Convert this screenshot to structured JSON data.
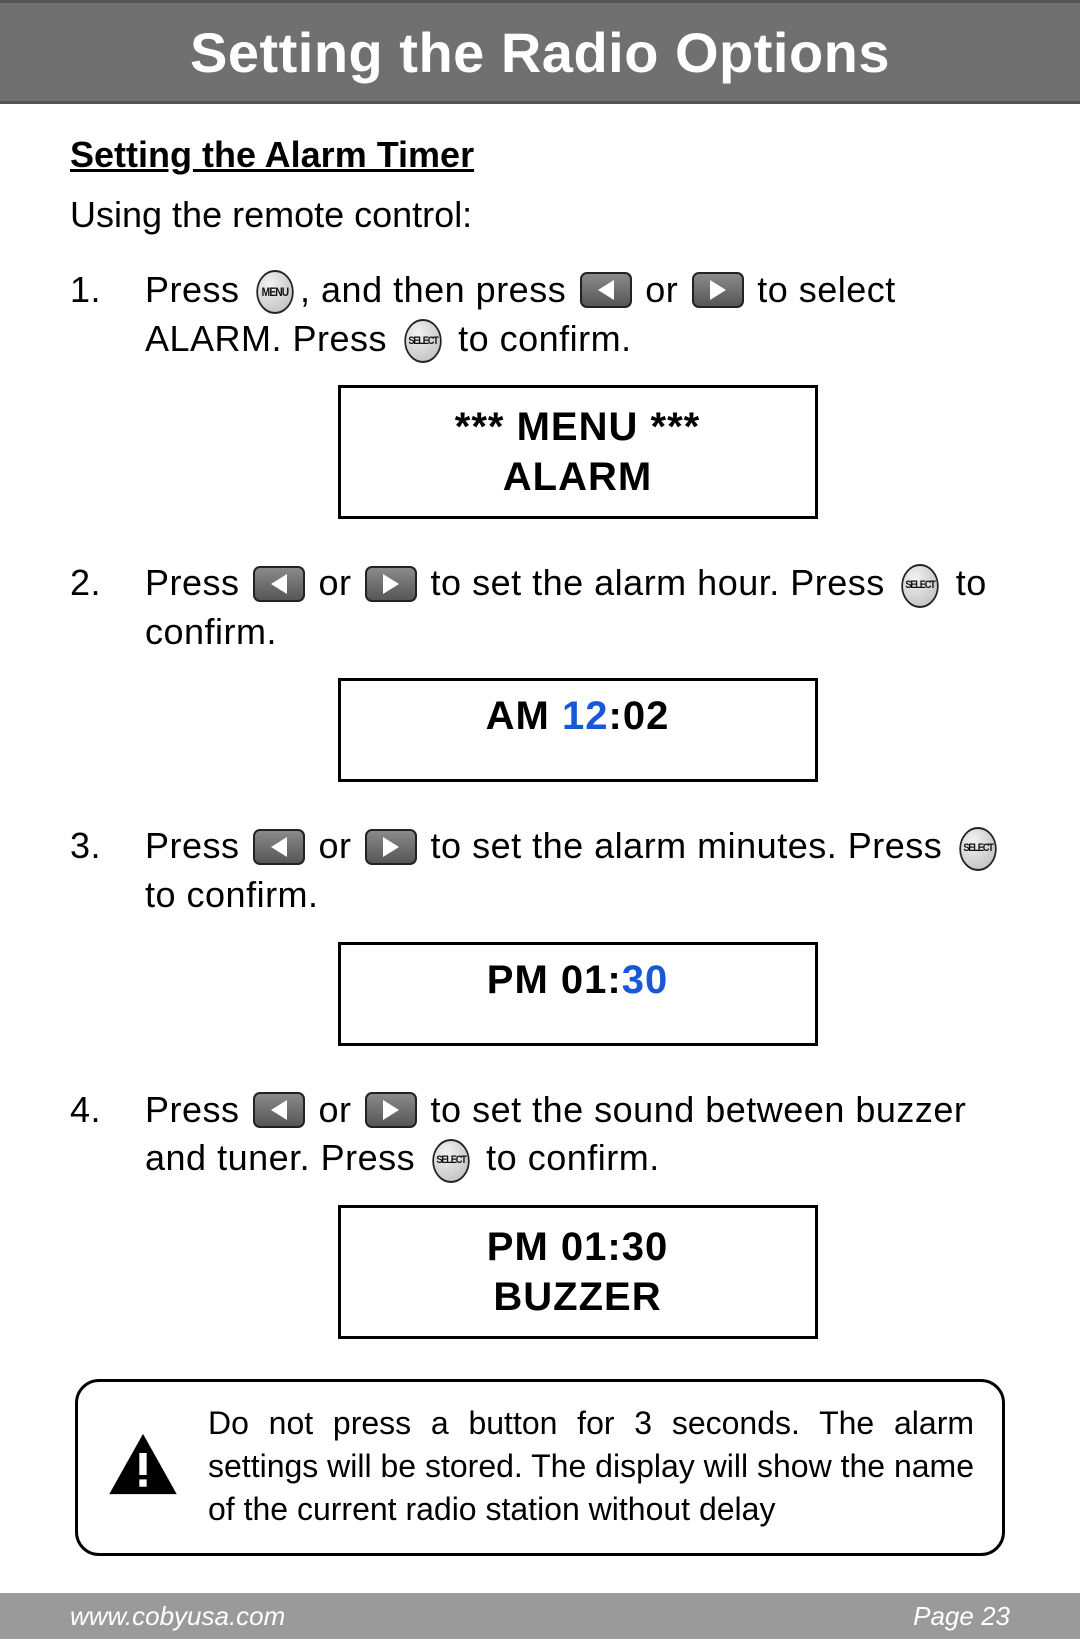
{
  "header": {
    "title": "Setting the Radio Options"
  },
  "subtitle": "Setting the Alarm Timer",
  "intro": "Using the remote control:",
  "buttons": {
    "menu": "MENU",
    "select": "SELECT"
  },
  "steps": [
    {
      "parts": {
        "a": "Press ",
        "b": ", and then press ",
        "c": " or ",
        "d": " to select ALARM. Press ",
        "e": " to confirm."
      },
      "lcd": {
        "line1": "*** MENU ***",
        "line2": "ALARM"
      }
    },
    {
      "parts": {
        "a": "Press ",
        "b": " or ",
        "c": " to set the alarm hour. Press ",
        "d": " to confirm."
      },
      "lcd": {
        "prefix": "AM  ",
        "hl": "12",
        "suffix": ":02"
      }
    },
    {
      "parts": {
        "a": "Press ",
        "b": " or ",
        "c": " to set the alarm minutes. Press ",
        "d": " to confirm."
      },
      "lcd": {
        "prefix": "PM  01:",
        "hl": "30",
        "suffix": ""
      }
    },
    {
      "parts": {
        "a": "Press ",
        "b": " or ",
        "c": " to set the sound between buzzer and tuner. Press ",
        "d": " to confirm."
      },
      "lcd": {
        "line1": "PM  01:30",
        "line2": "BUZZER"
      }
    }
  ],
  "note": "Do not press a button for 3 seconds.  The alarm settings will be stored.  The display will show the name of the current radio station without delay",
  "footer": {
    "url": "www.cobyusa.com",
    "page": "Page 23"
  }
}
